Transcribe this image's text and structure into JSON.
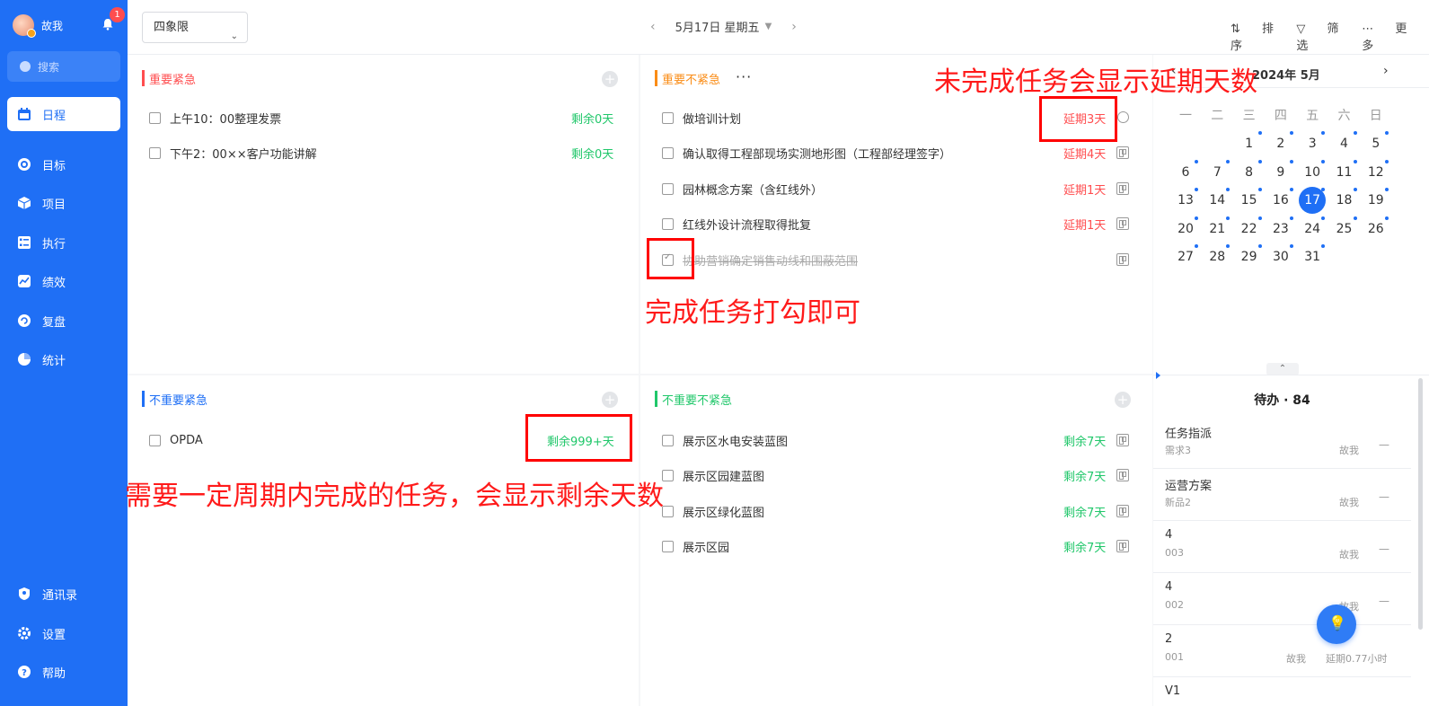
{
  "user": {
    "name": "故我",
    "badge": "1"
  },
  "sidebar": {
    "search_placeholder": "搜索",
    "items": [
      {
        "label": "日程",
        "icon": "calendar-icon"
      },
      {
        "label": "目标",
        "icon": "target-icon"
      },
      {
        "label": "项目",
        "icon": "cube-icon"
      },
      {
        "label": "执行",
        "icon": "checklist-icon"
      },
      {
        "label": "绩效",
        "icon": "chart-icon"
      },
      {
        "label": "复盘",
        "icon": "review-icon"
      },
      {
        "label": "统计",
        "icon": "pie-icon"
      }
    ],
    "bottom_items": [
      {
        "label": "通讯录",
        "icon": "contacts-icon"
      },
      {
        "label": "设置",
        "icon": "gear-icon"
      },
      {
        "label": "帮助",
        "icon": "help-icon"
      }
    ]
  },
  "topbar": {
    "view_select": "四象限",
    "date_label": "5月17日 星期五",
    "sort_label": "排序",
    "filter_label": "筛选",
    "more_label": "更多"
  },
  "quadrants": {
    "q1": {
      "title": "重要紧急",
      "tasks": [
        {
          "title": "上午10：00整理发票",
          "status": "剩余0天"
        },
        {
          "title": "下午2：00××客户功能讲解",
          "status": "剩余0天"
        }
      ]
    },
    "q2": {
      "title": "重要不紧急",
      "tasks": [
        {
          "title": "做培训计划",
          "status": "延期3天"
        },
        {
          "title": "确认取得工程部现场实测地形图（工程部经理签字）",
          "status": "延期4天"
        },
        {
          "title": "园林概念方案（含红线外）",
          "status": "延期1天"
        },
        {
          "title": "红线外设计流程取得批复",
          "status": "延期1天"
        },
        {
          "title": "协助营销确定销售动线和围蔽范围",
          "status": ""
        }
      ]
    },
    "q3": {
      "title": "不重要紧急",
      "tasks": [
        {
          "title": "OPDA",
          "status": "剩余999+天"
        }
      ]
    },
    "q4": {
      "title": "不重要不紧急",
      "tasks": [
        {
          "title": "展示区水电安装蓝图",
          "status": "剩余7天"
        },
        {
          "title": "展示区园建蓝图",
          "status": "剩余7天"
        },
        {
          "title": "展示区绿化蓝图",
          "status": "剩余7天"
        },
        {
          "title": "展示区园",
          "status": "剩余7天"
        }
      ]
    }
  },
  "calendar": {
    "title": "2024年 5月",
    "weekdays": [
      "一",
      "二",
      "三",
      "四",
      "五",
      "六",
      "日"
    ],
    "days": [
      "1",
      "2",
      "3",
      "4",
      "5",
      "6",
      "7",
      "8",
      "9",
      "10",
      "11",
      "12",
      "13",
      "14",
      "15",
      "16",
      "17",
      "18",
      "19",
      "20",
      "21",
      "22",
      "23",
      "24",
      "25",
      "26",
      "27",
      "28",
      "29",
      "30",
      "31"
    ],
    "today": "17"
  },
  "todo": {
    "header": "待办 · 84",
    "items": [
      {
        "title": "任务指派",
        "sub": "需求3",
        "owner": "故我",
        "extra": "—"
      },
      {
        "title": "运营方案",
        "sub": "新品2",
        "owner": "故我",
        "extra": "—"
      },
      {
        "title": "4",
        "sub": "003",
        "owner": "故我",
        "extra": "—"
      },
      {
        "title": "4",
        "sub": "002",
        "owner": "故我",
        "extra": "—"
      },
      {
        "title": "2",
        "sub": "001",
        "owner": "故我",
        "extra": "延期0.77小时"
      },
      {
        "title": "V1",
        "sub": "",
        "owner": "",
        "extra": ""
      }
    ]
  },
  "annotations": {
    "overdue": "未完成任务会显示延期天数",
    "check": "完成任务打勾即可",
    "remaining": "需要一定周期内完成的任务，会显示剩余天数"
  },
  "colors": {
    "brand": "#1f6ff5",
    "red": "#ff4d4f",
    "green": "#20c76a",
    "orange": "#fa8c16",
    "annotation": "#ff0000"
  }
}
